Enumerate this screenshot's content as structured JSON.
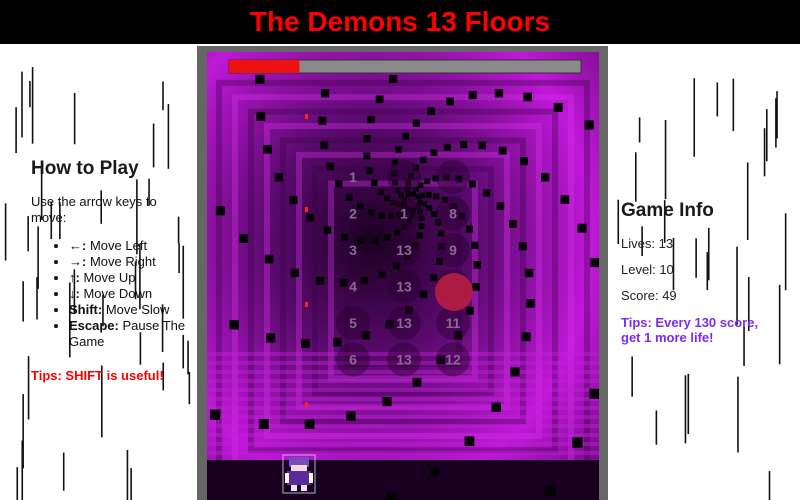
{
  "title": "The Demons 13 Floors",
  "how_to_play": {
    "heading": "How to Play",
    "intro": "Use the arrow keys to move:",
    "controls": [
      {
        "key": "←:",
        "action": "Move Left"
      },
      {
        "key": "→:",
        "action": "Move Right"
      },
      {
        "key": "↑:",
        "action": "Move Up"
      },
      {
        "key": "↓:",
        "action": "Move Down"
      },
      {
        "key": "Shift:",
        "action": "Move Slow"
      },
      {
        "key": "Escape:",
        "action": "Pause The Game"
      }
    ],
    "tip": "Tips: SHIFT is useful!"
  },
  "game_info": {
    "heading": "Game Info",
    "lives_label": "Lives:",
    "lives": "13",
    "level_label": "Level:",
    "level": "10",
    "score_label": "Score:",
    "score": "49",
    "tip": "Tips: Every 130 score, get 1 more life!"
  },
  "game": {
    "progress": 0.2,
    "floor_grid": [
      [
        "1",
        "",
        ""
      ],
      [
        "2",
        "1",
        "8"
      ],
      [
        "3",
        "13",
        "9"
      ],
      [
        "4",
        "13",
        ""
      ],
      [
        "5",
        "13",
        "11"
      ],
      [
        "6",
        "13",
        "12"
      ]
    ]
  },
  "colors": {
    "title": "#ff0000",
    "tip_left": "#ff0000",
    "tip_right": "#7c2cf0",
    "progress": "#ee1111",
    "board_magenta": "#b012c8"
  }
}
